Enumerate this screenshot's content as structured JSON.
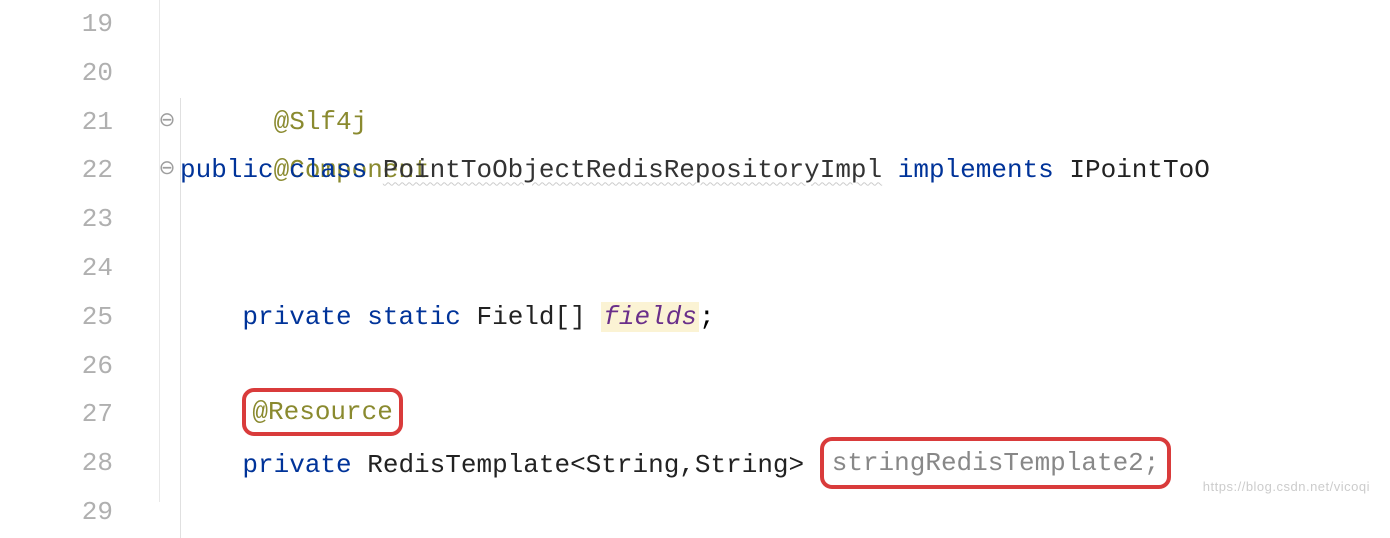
{
  "gutter": {
    "lines": [
      "19",
      "20",
      "21",
      "22",
      "23",
      "24",
      "25",
      "26",
      "27",
      "28",
      "29"
    ]
  },
  "code": {
    "l20_annotation": "@Slf4j",
    "l21_annotation": "@Component",
    "l22_public": "public",
    "l22_class": "class",
    "l22_classname": "PointToObjectRedisRepositoryImpl",
    "l22_implements": "implements",
    "l22_iface": "IPointToO",
    "l25_private": "private",
    "l25_static": "static",
    "l25_type": "Field[]",
    "l25_field": "fields",
    "l25_semi": ";",
    "l27_annotation": "@Resource",
    "l28_private": "private",
    "l28_type": "RedisTemplate<String,String>",
    "l28_var": "stringRedisTemplate2;"
  },
  "watermark": "https://blog.csdn.net/vicoqi"
}
